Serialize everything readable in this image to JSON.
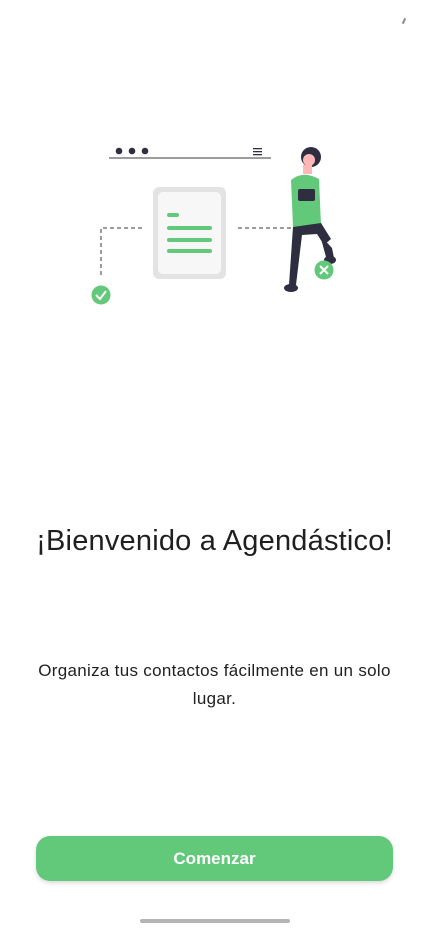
{
  "welcome": {
    "title": "¡Bienvenido a Agendástico!",
    "subtitle": "Organiza tus contactos fácilmente en un solo lugar.",
    "primary_button_label": "Comenzar"
  },
  "illustration": {
    "icons": [
      "document-icon",
      "check-circle-icon",
      "close-circle-icon",
      "person-illustration"
    ]
  },
  "colors": {
    "accent": "#62c97a",
    "text": "#1f1f1f",
    "background": "#ffffff"
  }
}
